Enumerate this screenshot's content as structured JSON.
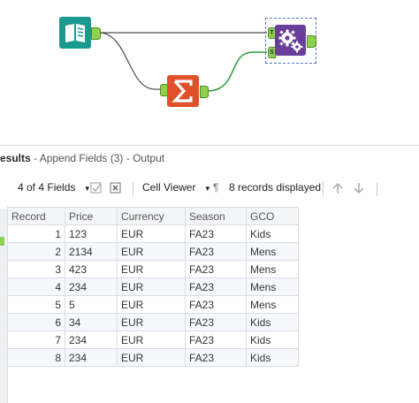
{
  "results": {
    "title_bold": "esults",
    "title_rest": " - Append Fields (3) - Output"
  },
  "toolbar": {
    "fields_label": "4 of 4 Fields",
    "viewer_label": "Cell Viewer",
    "records_label": "8 records displayed"
  },
  "table": {
    "headers": [
      "Record",
      "Price",
      "Currency",
      "Season",
      "GCO"
    ],
    "rows": [
      [
        "1",
        "123",
        "EUR",
        "FA23",
        "Kids"
      ],
      [
        "2",
        "2134",
        "EUR",
        "FA23",
        "Mens"
      ],
      [
        "3",
        "423",
        "EUR",
        "FA23",
        "Mens"
      ],
      [
        "4",
        "234",
        "EUR",
        "FA23",
        "Mens"
      ],
      [
        "5",
        "5",
        "EUR",
        "FA23",
        "Mens"
      ],
      [
        "6",
        "34",
        "EUR",
        "FA23",
        "Kids"
      ],
      [
        "7",
        "234",
        "EUR",
        "FA23",
        "Kids"
      ],
      [
        "8",
        "234",
        "EUR",
        "FA23",
        "Kids"
      ]
    ]
  },
  "workflow": {
    "input_tool_icon": "book-icon",
    "summarize_tool_icon": "sigma-icon",
    "append_tool_icon": "gears-icon",
    "anchor_t": "T",
    "anchor_s": "S"
  },
  "colors": {
    "input_tool": "#1a9a8e",
    "summarize_tool": "#e0502a",
    "append_tool": "#6a3f9c",
    "anchor": "#8fd14f"
  }
}
